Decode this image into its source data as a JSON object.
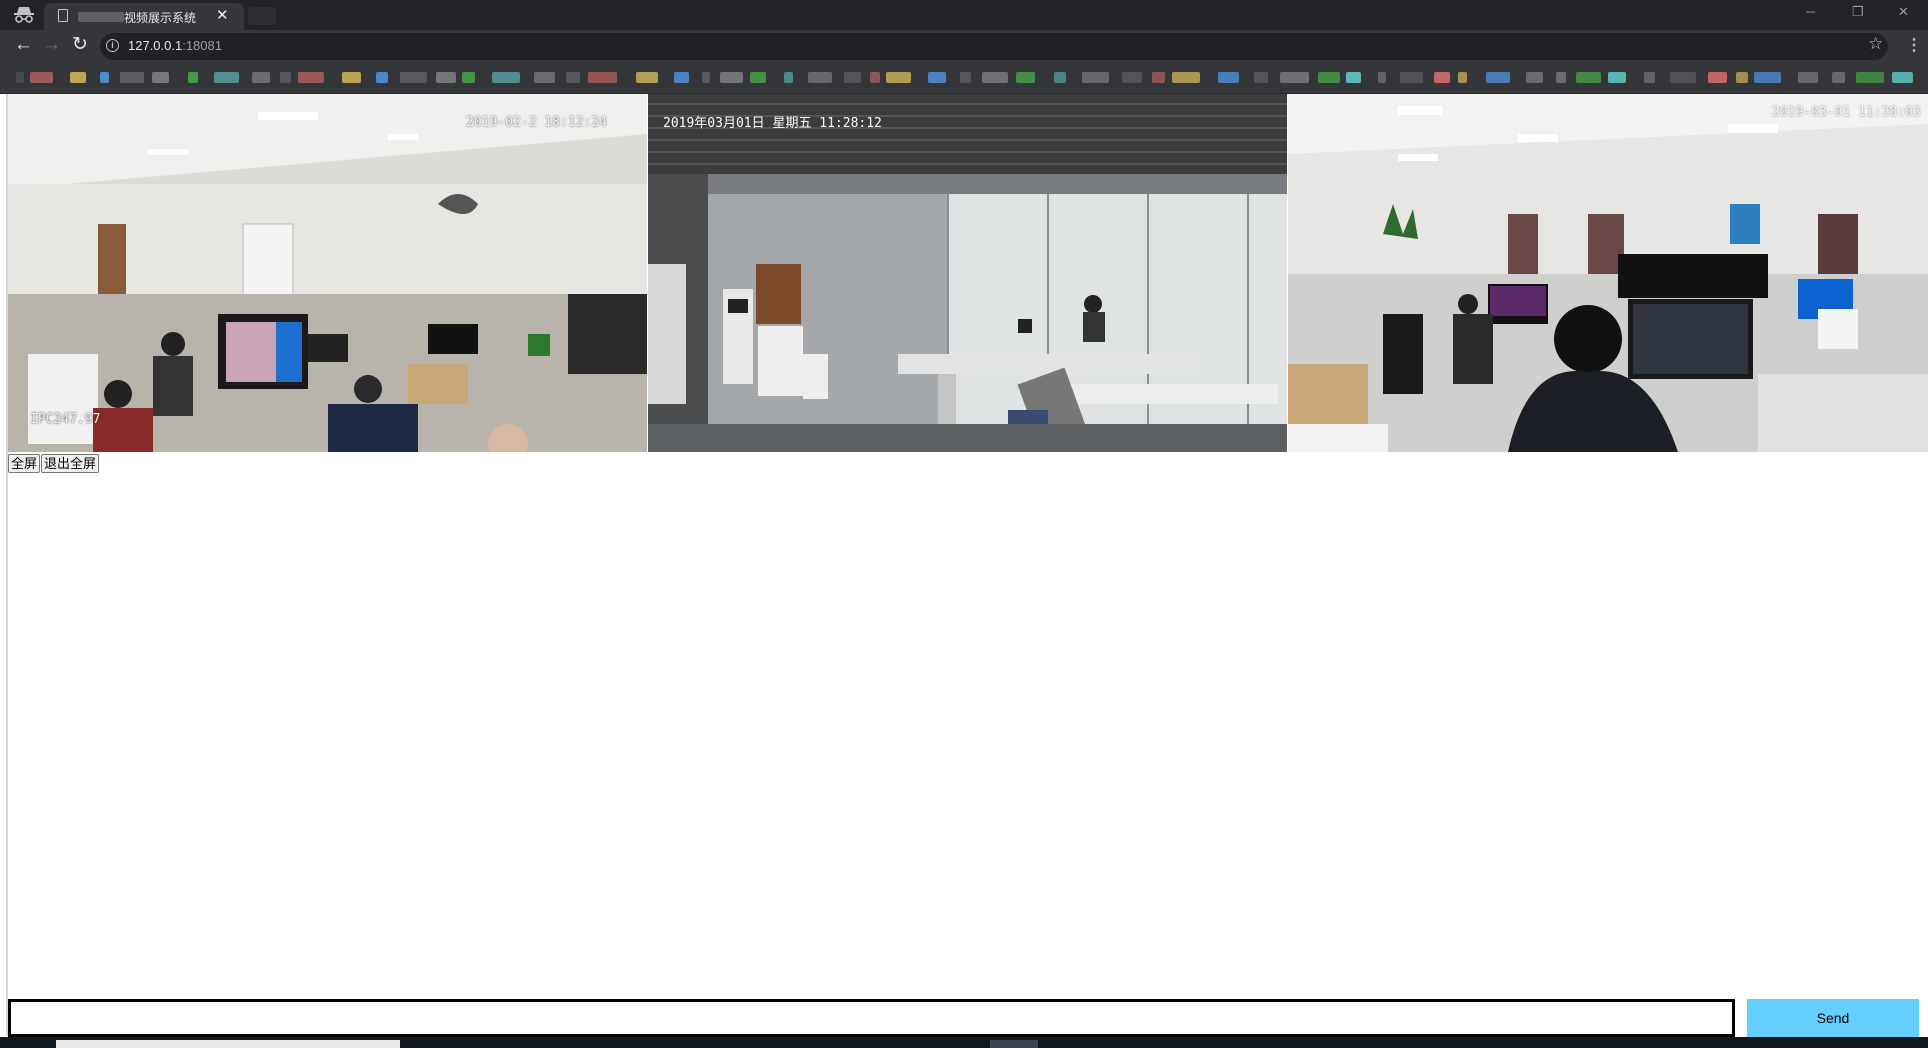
{
  "window": {
    "tab_title": "视频展示系统",
    "tab_close": "✕",
    "controls": {
      "minimize": "─",
      "restore": "❐",
      "close": "✕"
    }
  },
  "address_bar": {
    "host": "127.0.0.1",
    "port": ":18081",
    "info_icon": "i",
    "back_icon": "←",
    "forward_icon": "→",
    "reload_icon": "↻",
    "star_icon": "☆",
    "menu_icon": "⋮"
  },
  "cameras": [
    {
      "name": "camera-feed-1",
      "timestamp": "2019-02-2  18:12:24",
      "channel_label": "IPC247.97"
    },
    {
      "name": "camera-feed-2",
      "timestamp": "2019年03月01日  星期五  11:28:12"
    },
    {
      "name": "camera-feed-3",
      "timestamp": "2019-03-01 11:28:03"
    }
  ],
  "controls": {
    "fullscreen_label": "全屏",
    "exit_fullscreen_label": "退出全屏"
  },
  "message": {
    "input_value": "",
    "send_label": "Send"
  },
  "colors": {
    "tab_bar": "#222326",
    "toolbar": "#35363a",
    "send_button": "#64ceff"
  }
}
